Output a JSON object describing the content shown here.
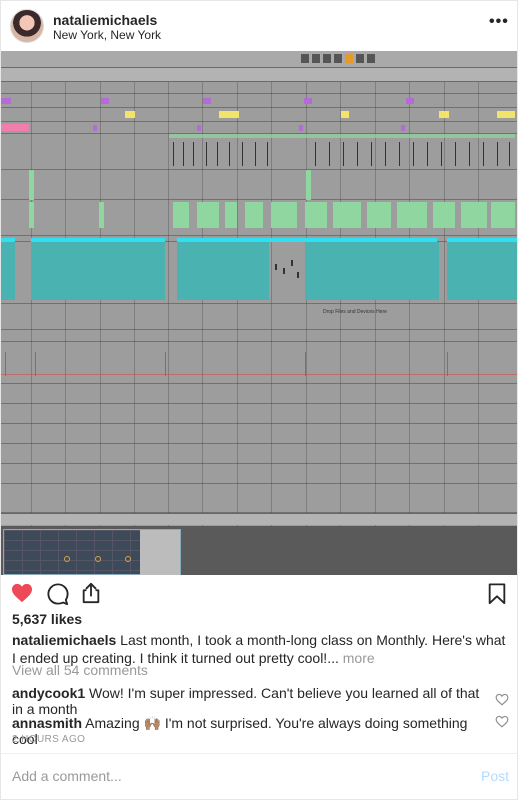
{
  "header": {
    "username": "nataliemichaels",
    "location": "New York, New York"
  },
  "daw": {
    "drop_text": "Drop Files and Devices Here"
  },
  "actions": {
    "liked": true,
    "like_color": "#ed4956"
  },
  "likes": "5,637 likes",
  "caption": {
    "username": "nataliemichaels",
    "text": " Last month, I took a month-long class on Monthly. Here's what I ended up creating. I think it turned out pretty cool!...",
    "more": " more"
  },
  "view_all_comments": "View all 54 comments",
  "comments": [
    {
      "username": "andycook1",
      "text": " Wow! I'm super impressed. Can't believe you learned all of that in a month"
    },
    {
      "username": "annasmith",
      "text": " Amazing 🙌🏽  I'm not surprised. You're always doing something cool"
    }
  ],
  "timestamp": "2 HOURS AGO",
  "add_comment_placeholder": "Add a comment...",
  "post_label": "Post",
  "colors": {
    "post_button": "#b3dbff",
    "muted_text": "#999999"
  }
}
